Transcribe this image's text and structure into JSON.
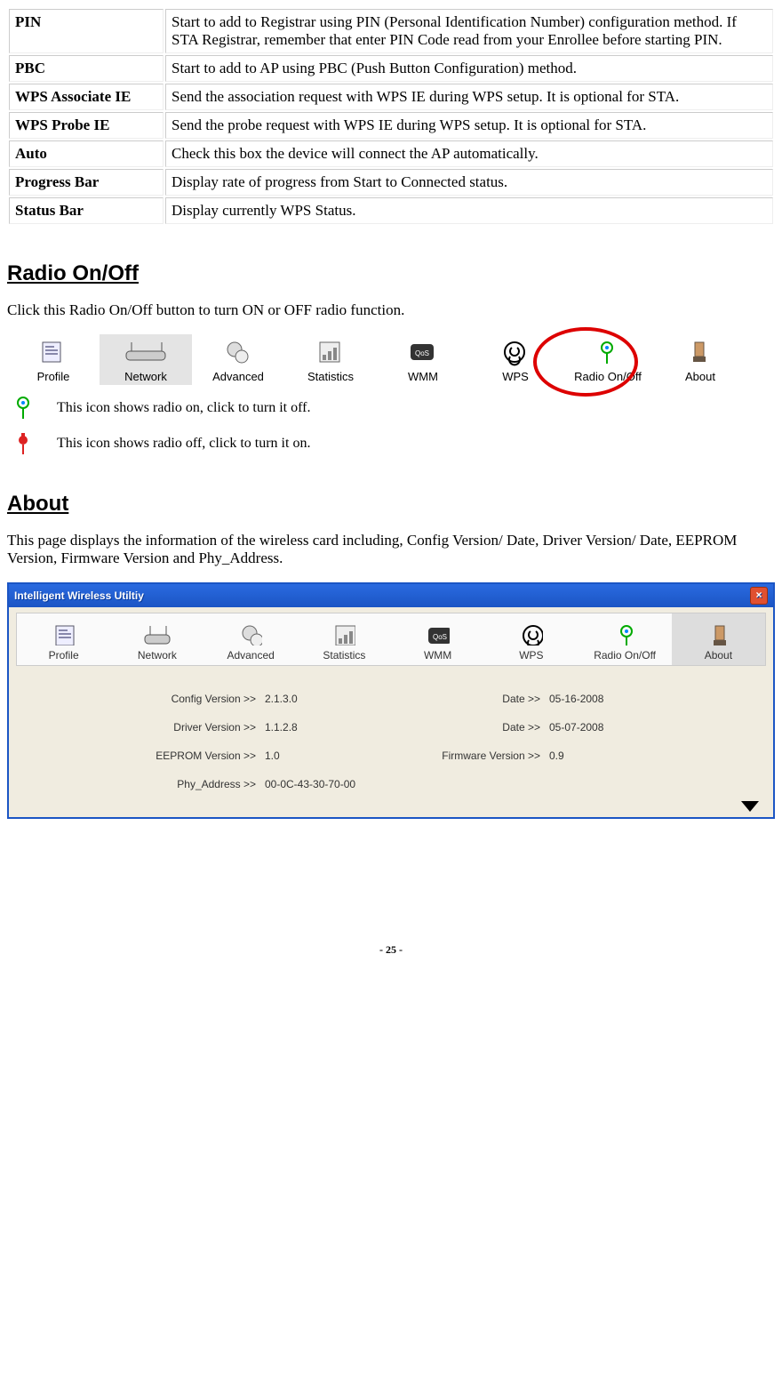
{
  "definitions": [
    {
      "term": "PIN",
      "desc": "Start to add to Registrar using PIN (Personal Identification Number) configuration method. If STA Registrar, remember that enter PIN Code read from your Enrollee before starting PIN."
    },
    {
      "term": "PBC",
      "desc": "Start to add to AP using PBC (Push Button Configuration) method."
    },
    {
      "term": "WPS Associate IE",
      "desc": "Send the association request with WPS IE during WPS setup. It is optional for STA."
    },
    {
      "term": "WPS Probe IE",
      "desc": "Send the probe request with WPS IE during WPS setup. It is optional for STA."
    },
    {
      "term": "Auto",
      "desc": "Check this box the device will connect the AP automatically."
    },
    {
      "term": "Progress Bar",
      "desc": "Display rate of progress from Start to Connected status."
    },
    {
      "term": "Status Bar",
      "desc": "Display currently WPS Status."
    }
  ],
  "radio_section": {
    "heading": "Radio On/Off",
    "intro": "Click this Radio On/Off button to turn ON or OFF radio function.",
    "toolbar": [
      "Profile",
      "Network",
      "Advanced",
      "Statistics",
      "WMM",
      "WPS",
      "Radio On/Off",
      "About"
    ],
    "selected_index": 1,
    "circled_index": 6,
    "legend_on": "This icon shows radio on, click to turn it off.",
    "legend_off": "This icon shows radio off, click to turn it on."
  },
  "about_section": {
    "heading": "About",
    "intro": "This page displays the information of the wireless card including, Config Version/ Date, Driver Version/ Date, EEPROM Version, Firmware Version and Phy_Address.",
    "window_title": "Intelligent Wireless Utiltiy",
    "toolbar": [
      "Profile",
      "Network",
      "Advanced",
      "Statistics",
      "WMM",
      "WPS",
      "Radio On/Off",
      "About"
    ],
    "selected_index": 7,
    "rows": [
      {
        "l1": "Config Version >>",
        "v1": "2.1.3.0",
        "l2": "Date >>",
        "v2": "05-16-2008"
      },
      {
        "l1": "Driver Version >>",
        "v1": "1.1.2.8",
        "l2": "Date >>",
        "v2": "05-07-2008"
      },
      {
        "l1": "EEPROM Version >>",
        "v1": "1.0",
        "l2": "Firmware Version >>",
        "v2": "0.9"
      },
      {
        "l1": "Phy_Address >>",
        "v1": "00-0C-43-30-70-00",
        "l2": "",
        "v2": ""
      }
    ]
  },
  "page_number": "- 25 -"
}
